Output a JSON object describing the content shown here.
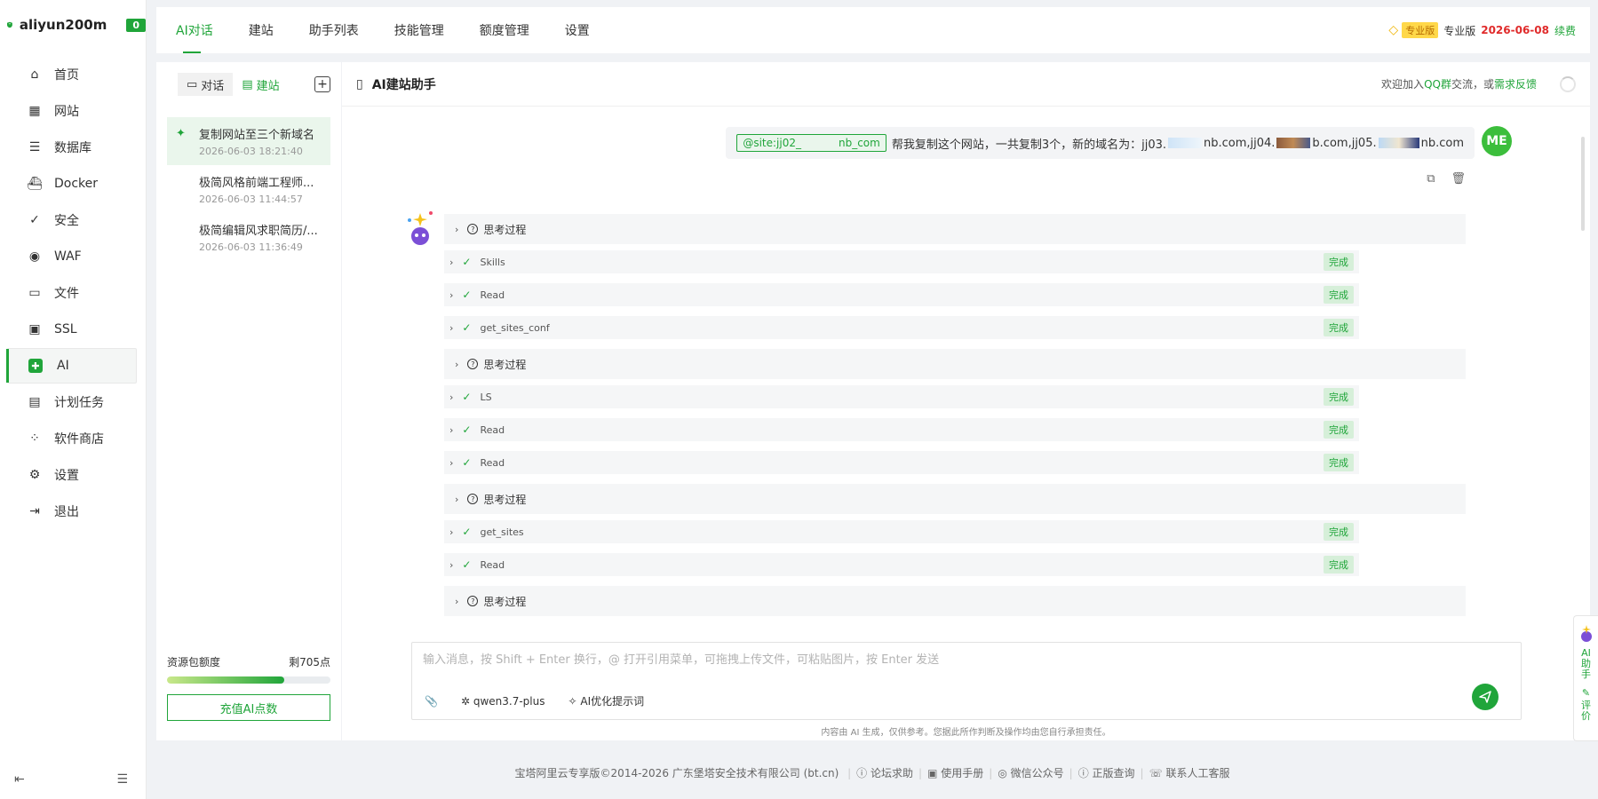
{
  "brand": {
    "name": "aliyun200m",
    "badge": "0"
  },
  "nav": {
    "items": [
      {
        "label": "首页",
        "icon": "home-icon"
      },
      {
        "label": "网站",
        "icon": "website-icon"
      },
      {
        "label": "数据库",
        "icon": "database-icon"
      },
      {
        "label": "Docker",
        "icon": "docker-icon"
      },
      {
        "label": "安全",
        "icon": "security-icon"
      },
      {
        "label": "WAF",
        "icon": "waf-icon"
      },
      {
        "label": "文件",
        "icon": "folder-icon"
      },
      {
        "label": "SSL",
        "icon": "ssl-icon"
      },
      {
        "label": "AI",
        "icon": "ai-icon"
      },
      {
        "label": "计划任务",
        "icon": "calendar-icon"
      },
      {
        "label": "软件商店",
        "icon": "store-icon"
      },
      {
        "label": "设置",
        "icon": "settings-icon"
      },
      {
        "label": "退出",
        "icon": "logout-icon"
      }
    ],
    "active_index": 8
  },
  "tabs": [
    "AI对话",
    "建站",
    "助手列表",
    "技能管理",
    "额度管理",
    "设置"
  ],
  "topright": {
    "pro_tag": "专业版",
    "edition": "专业版",
    "expire": "2026-06-08",
    "renew": "续费"
  },
  "convo": {
    "seg_chat": "对话",
    "seg_build": "建站",
    "sessions": [
      {
        "title": "复制网站至三个新域名",
        "date": "2026-06-03 18:21:40"
      },
      {
        "title": "极简风格前端工程师...",
        "date": "2026-06-03 11:44:57"
      },
      {
        "title": "极简编辑风求职简历/...",
        "date": "2026-06-03 11:36:49"
      }
    ],
    "quota_label": "资源包额度",
    "quota_remain": "剩705点",
    "quota_fraction": 0.72,
    "recharge": "充值AI点数"
  },
  "chat": {
    "title": "AI建站助手",
    "welcome_pre": "欢迎加入",
    "welcome_qq": "QQ群",
    "welcome_mid": "交流，或",
    "welcome_fb": "需求反馈",
    "site_tag_a": "@site:jj02_",
    "site_tag_b": "nb_com",
    "user_text_a": "帮我复制这个网站，一共复制3个，新的域名为：jj03.",
    "user_text_b": "nb.com,jj04.",
    "user_text_c": "b.com,jj05.",
    "user_text_d": "nb.com",
    "avatar": "ME",
    "think_label": "思考过程",
    "done_label": "完成",
    "steps": [
      {
        "type": "think"
      },
      {
        "type": "tool",
        "name": "Skills"
      },
      {
        "type": "tool",
        "name": "Read"
      },
      {
        "type": "tool",
        "name": "get_sites_conf"
      },
      {
        "type": "think"
      },
      {
        "type": "tool",
        "name": "LS"
      },
      {
        "type": "tool",
        "name": "Read"
      },
      {
        "type": "tool",
        "name": "Read"
      },
      {
        "type": "think"
      },
      {
        "type": "tool",
        "name": "get_sites"
      },
      {
        "type": "tool",
        "name": "Read"
      },
      {
        "type": "think"
      }
    ],
    "placeholder": "输入消息，按 Shift + Enter 换行，@ 打开引用菜单，可拖拽上传文件，可粘贴图片，按 Enter 发送",
    "model": "qwen3.7-plus",
    "optimize": "AI优化提示词",
    "disclaimer": "内容由 AI 生成，仅供参考。您据此所作判断及操作均由您自行承担责任。"
  },
  "float_ai": {
    "a": "AI",
    "b": "助",
    "c": "手",
    "d": "评",
    "e": "价"
  },
  "footer": {
    "copyright": "宝塔阿里云专享版©2014-2026 广东堡塔安全技术有限公司 (bt.cn)",
    "links": [
      "论坛求助",
      "使用手册",
      "微信公众号",
      "正版查询",
      "联系人工客服"
    ]
  },
  "colors": {
    "accent": "#20a53a",
    "danger": "#e02b2b"
  }
}
